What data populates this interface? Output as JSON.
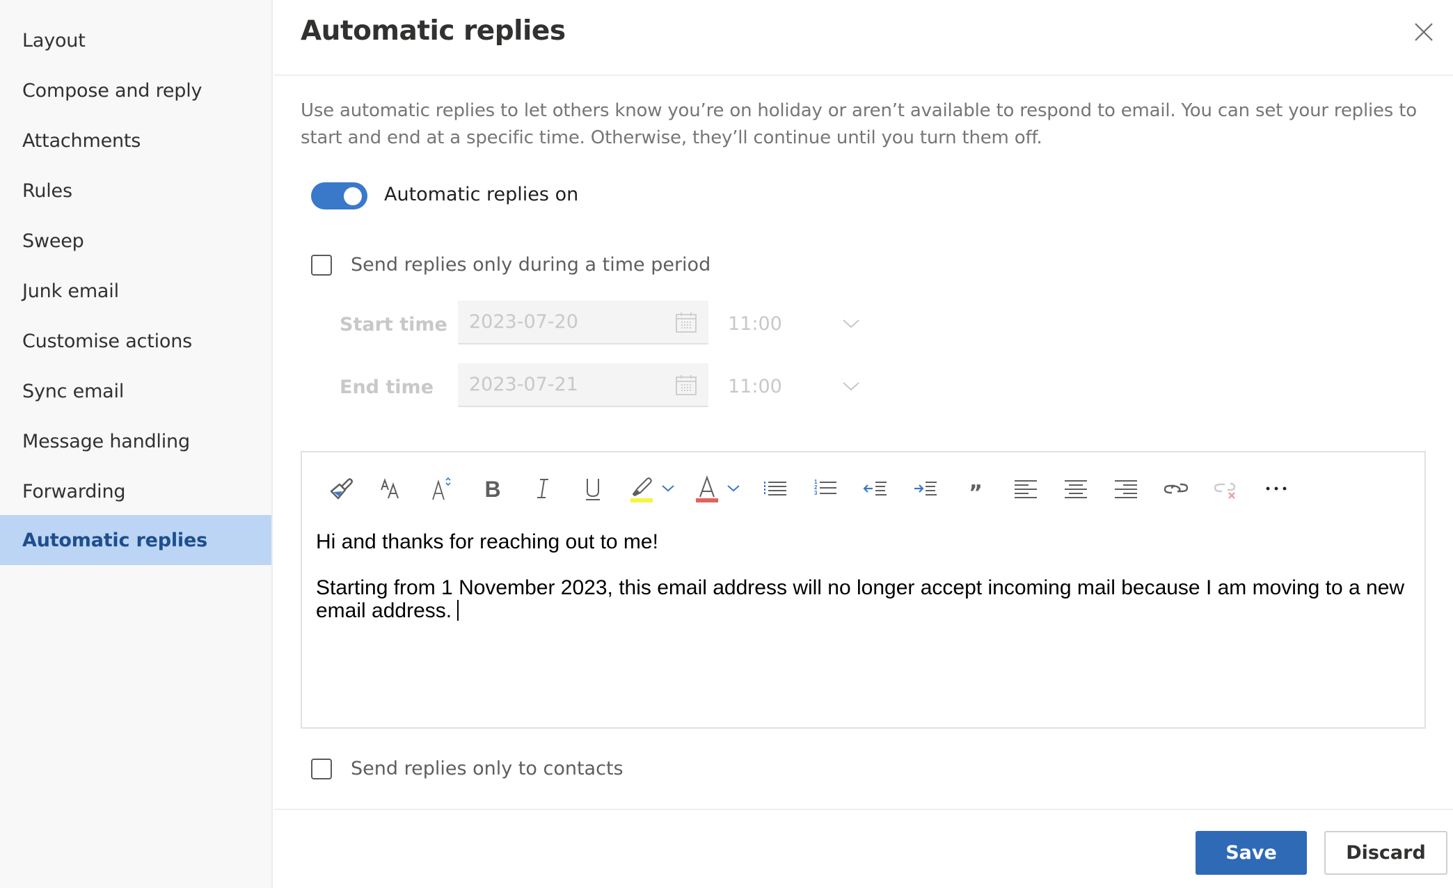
{
  "sidebar": {
    "items": [
      {
        "label": "Layout",
        "active": false
      },
      {
        "label": "Compose and reply",
        "active": false
      },
      {
        "label": "Attachments",
        "active": false
      },
      {
        "label": "Rules",
        "active": false
      },
      {
        "label": "Sweep",
        "active": false
      },
      {
        "label": "Junk email",
        "active": false
      },
      {
        "label": "Customise actions",
        "active": false
      },
      {
        "label": "Sync email",
        "active": false
      },
      {
        "label": "Message handling",
        "active": false
      },
      {
        "label": "Forwarding",
        "active": false
      },
      {
        "label": "Automatic replies",
        "active": true
      }
    ]
  },
  "header": {
    "title": "Automatic replies",
    "close_icon": "close-icon"
  },
  "description": "Use automatic replies to let others know you’re on holiday or aren’t available to respond to email. You can set your replies to start and end at a specific time. Otherwise, they’ll continue until you turn them off.",
  "toggle": {
    "label": "Automatic replies on",
    "on": true
  },
  "time_period": {
    "checkbox_label": "Send replies only during a time period",
    "checked": false,
    "start": {
      "label": "Start time",
      "date": "2023-07-20",
      "time": "11:00"
    },
    "end": {
      "label": "End time",
      "date": "2023-07-21",
      "time": "11:00"
    }
  },
  "editor": {
    "toolbar": [
      {
        "name": "format-painter-icon",
        "title": "Format painter"
      },
      {
        "name": "font-icon",
        "title": "Font"
      },
      {
        "name": "font-size-icon",
        "title": "Font size"
      },
      {
        "name": "bold-icon",
        "title": "Bold"
      },
      {
        "name": "italic-icon",
        "title": "Italic"
      },
      {
        "name": "underline-icon",
        "title": "Underline"
      },
      {
        "name": "highlight-icon",
        "title": "Highlight"
      },
      {
        "name": "font-color-icon",
        "title": "Font color"
      },
      {
        "name": "bullets-icon",
        "title": "Bullets"
      },
      {
        "name": "numbering-icon",
        "title": "Numbering"
      },
      {
        "name": "decrease-indent-icon",
        "title": "Decrease indent"
      },
      {
        "name": "increase-indent-icon",
        "title": "Increase indent"
      },
      {
        "name": "quote-icon",
        "title": "Quote"
      },
      {
        "name": "align-left-icon",
        "title": "Align left"
      },
      {
        "name": "align-center-icon",
        "title": "Align center"
      },
      {
        "name": "align-right-icon",
        "title": "Align right"
      },
      {
        "name": "link-icon",
        "title": "Insert link"
      },
      {
        "name": "remove-link-icon",
        "title": "Remove link"
      },
      {
        "name": "more-options-icon",
        "title": "More options"
      }
    ],
    "highlight_color": "#f5f542",
    "font_color": "#e0645c",
    "body": {
      "line1": "Hi and thanks for reaching out to me!",
      "line2": "Starting from 1 November 2023, this email address will no longer accept incoming mail because I am moving to a new email address."
    }
  },
  "contacts": {
    "checkbox_label": "Send replies only to contacts",
    "checked": false
  },
  "footer": {
    "save_label": "Save",
    "discard_label": "Discard"
  },
  "colors": {
    "accent": "#2f6ab7",
    "toggle_on": "#3a78c9",
    "sidebar_active_bg": "#bcd5f5",
    "sidebar_active_text": "#1f4e8c"
  }
}
